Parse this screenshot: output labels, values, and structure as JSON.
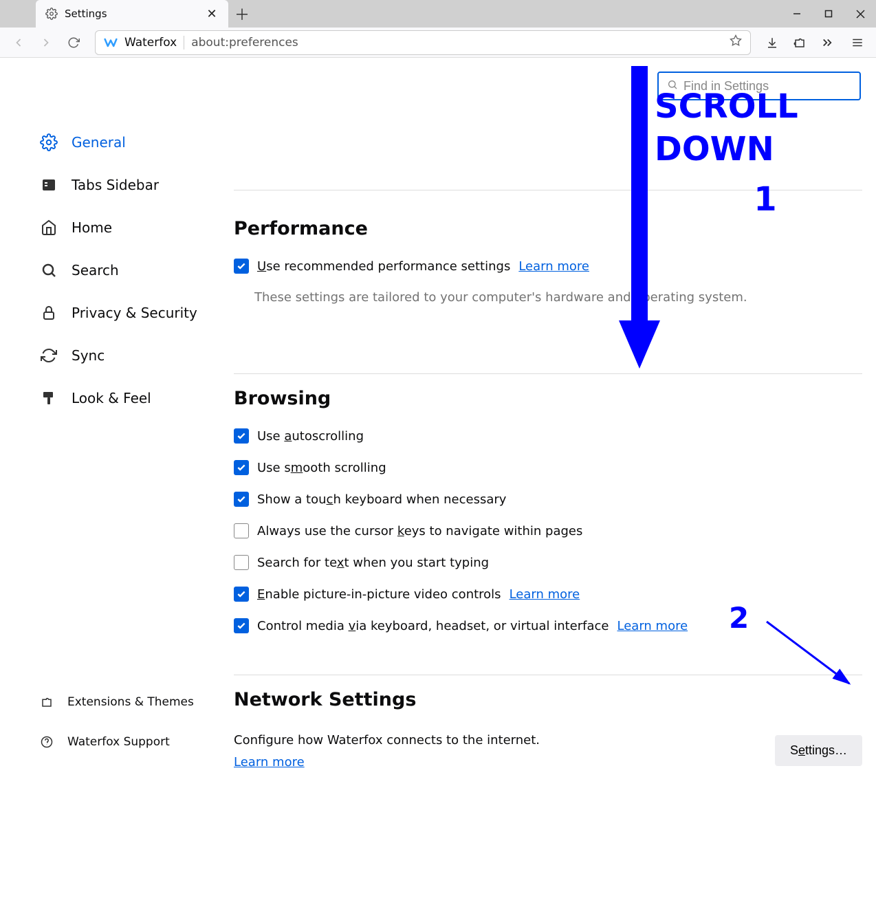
{
  "window": {
    "tab_title": "Settings",
    "identity": "Waterfox",
    "url": "about:preferences"
  },
  "search": {
    "placeholder": "Find in Settings"
  },
  "sidebar": {
    "items": [
      {
        "label": "General"
      },
      {
        "label": "Tabs Sidebar"
      },
      {
        "label": "Home"
      },
      {
        "label": "Search"
      },
      {
        "label": "Privacy & Security"
      },
      {
        "label": "Sync"
      },
      {
        "label": "Look & Feel"
      }
    ],
    "bottom": [
      {
        "label": "Extensions & Themes"
      },
      {
        "label": "Waterfox Support"
      }
    ]
  },
  "sections": {
    "performance": {
      "title": "Performance",
      "opt1_pre": "U",
      "opt1_post": "se recommended performance settings",
      "learn": "Learn more",
      "hint": "These settings are tailored to your computer's hardware and operating system."
    },
    "browsing": {
      "title": "Browsing",
      "opts": [
        {
          "pre": "Use ",
          "ul": "a",
          "post": "utoscrolling",
          "checked": true
        },
        {
          "pre": "Use s",
          "ul": "m",
          "post": "ooth scrolling",
          "checked": true
        },
        {
          "pre": "Show a tou",
          "ul": "c",
          "post": "h keyboard when necessary",
          "checked": true
        },
        {
          "pre": "Always use the cursor ",
          "ul": "k",
          "post": "eys to navigate within pages",
          "checked": false
        },
        {
          "pre": "Search for te",
          "ul": "x",
          "post": "t when you start typing",
          "checked": false
        },
        {
          "pre": "",
          "ul": "E",
          "post": "nable picture-in-picture video controls",
          "checked": true,
          "learn": "Learn more"
        },
        {
          "pre": "Control media ",
          "ul": "v",
          "post": "ia keyboard, headset, or virtual interface",
          "checked": true,
          "learn": "Learn more"
        }
      ]
    },
    "network": {
      "title": "Network Settings",
      "desc": "Configure how Waterfox connects to the internet.",
      "learn": "Learn more",
      "btn_pre": "S",
      "btn_ul": "e",
      "btn_post": "ttings…"
    }
  },
  "annotations": {
    "scroll": "SCROLL DOWN",
    "num1": "1",
    "num2": "2"
  }
}
